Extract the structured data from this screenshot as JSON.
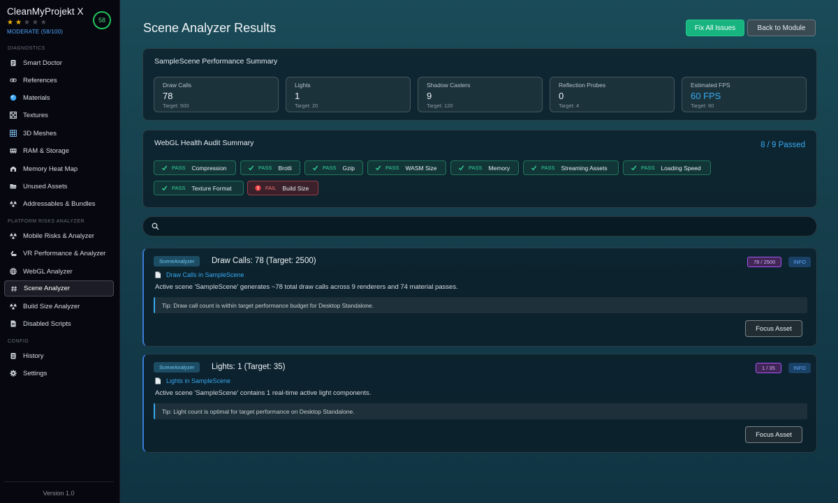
{
  "app": {
    "name": "CleanMyProjekt X",
    "rating_stars": 2,
    "rating_max": 5,
    "status": "MODERATE (58/100)",
    "score": "58",
    "version": "Version 1.0"
  },
  "sidebar": {
    "sections": {
      "diagnostics": "DIAGNOSTICS",
      "platform": "PLATFORM RISKS ANALYZER",
      "config": "CONFIG"
    },
    "items": [
      {
        "label": "Smart Doctor",
        "icon": "clipboard-icon"
      },
      {
        "label": "References",
        "icon": "link-icon"
      },
      {
        "label": "Materials",
        "icon": "sphere-icon"
      },
      {
        "label": "Textures",
        "icon": "checker-icon"
      },
      {
        "label": "3D Meshes",
        "icon": "grid-icon"
      },
      {
        "label": "RAM & Storage",
        "icon": "ram-icon"
      },
      {
        "label": "Memory Heat Map",
        "icon": "heatmap-icon"
      },
      {
        "label": "Unused Assets",
        "icon": "folder-open-icon"
      },
      {
        "label": "Addressables & Bundles",
        "icon": "radiation-icon"
      },
      {
        "label": "Mobile Risks & Analyzer",
        "icon": "radiation-icon"
      },
      {
        "label": "VR Performance & Analyzer",
        "icon": "headset-icon"
      },
      {
        "label": "WebGL Analyzer",
        "icon": "globe-icon"
      },
      {
        "label": "Scene Analyzer",
        "icon": "hash-icon",
        "active": true
      },
      {
        "label": "Build Size Analyzer",
        "icon": "radiation-icon"
      },
      {
        "label": "Disabled Scripts",
        "icon": "script-icon"
      },
      {
        "label": "History",
        "icon": "history-icon"
      },
      {
        "label": "Settings",
        "icon": "gear-icon"
      }
    ]
  },
  "header": {
    "title": "Scene Analyzer Results",
    "fix_all": "Fix All Issues",
    "back": "Back to Module"
  },
  "summary": {
    "title": "SampleScene Performance Summary",
    "metrics": [
      {
        "label": "Draw Calls",
        "value": "78",
        "target": "Target: 500"
      },
      {
        "label": "Lights",
        "value": "1",
        "target": "Target: 20"
      },
      {
        "label": "Shadow Casters",
        "value": "9",
        "target": "Target: 120"
      },
      {
        "label": "Reflection Probes",
        "value": "0",
        "target": "Target: 4"
      },
      {
        "label": "Estimated FPS",
        "value": "60 FPS",
        "target": "Target: 60"
      }
    ]
  },
  "webgl": {
    "title": "WebGL Health Audit Summary",
    "passed": "8 / 9 Passed",
    "checks": [
      {
        "status": "PASS",
        "label": "Compression"
      },
      {
        "status": "PASS",
        "label": "Brotli"
      },
      {
        "status": "PASS",
        "label": "Gzip"
      },
      {
        "status": "PASS",
        "label": "WASM Size"
      },
      {
        "status": "PASS",
        "label": "Memory"
      },
      {
        "status": "PASS",
        "label": "Streaming Assets"
      },
      {
        "status": "PASS",
        "label": "Loading Speed"
      },
      {
        "status": "PASS",
        "label": "Texture Format"
      },
      {
        "status": "FAIL",
        "label": "Build Size"
      }
    ]
  },
  "search": {
    "placeholder": "",
    "value": ""
  },
  "issues": [
    {
      "source": "SceneAnalyzer",
      "title": "Draw Calls: 78 (Target: 2500)",
      "ratio": "78 / 2500",
      "severity": "INFO",
      "file": "Draw Calls in SampleScene",
      "description": "Active scene 'SampleScene' generates ~78 total draw calls across 9 renderers and 74 material passes.",
      "tip": "Tip: Draw call count is within target performance budget for Desktop Standalone.",
      "action": "Focus Asset"
    },
    {
      "source": "SceneAnalyzer",
      "title": "Lights: 1 (Target: 35)",
      "ratio": "1 / 35",
      "severity": "INFO",
      "file": "Lights in SampleScene",
      "description": "Active scene 'SampleScene' contains 1 real-time active light components.",
      "tip": "Tip: Light count is optimal for target performance on Desktop Standalone.",
      "action": "Focus Asset"
    }
  ],
  "colors": {
    "accent": "#38a9f0",
    "success": "#18b47f",
    "fail": "#f87171",
    "score_ring": "#22c55e"
  }
}
